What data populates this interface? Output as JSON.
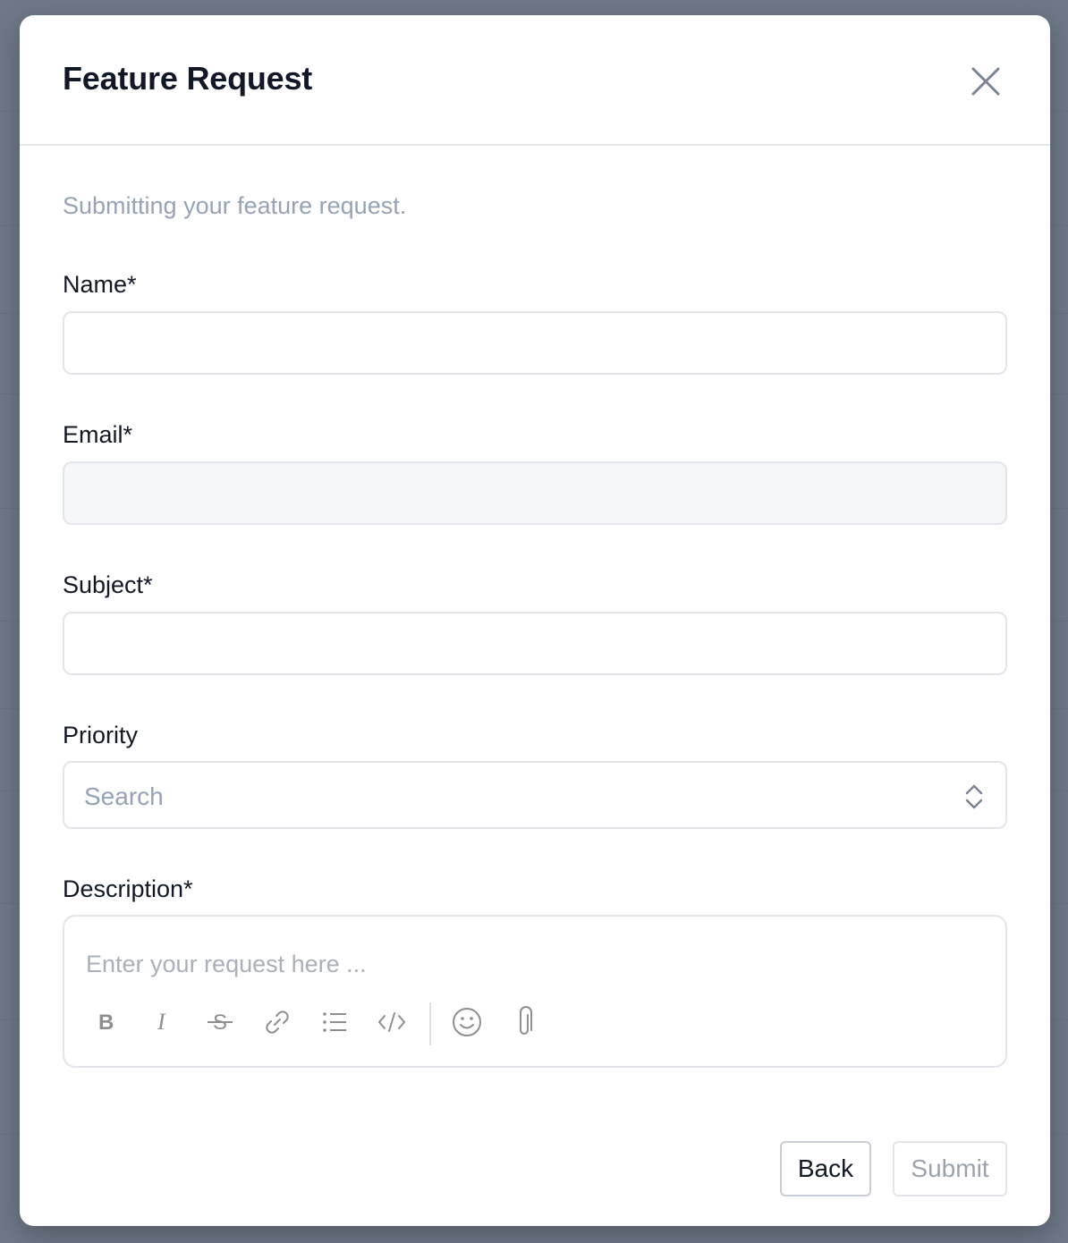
{
  "modal": {
    "title": "Feature Request",
    "subtitle": "Submitting your feature request."
  },
  "form": {
    "name": {
      "label": "Name*",
      "value": ""
    },
    "email": {
      "label": "Email*",
      "value": ""
    },
    "subject": {
      "label": "Subject*",
      "value": ""
    },
    "priority": {
      "label": "Priority",
      "placeholder": "Search"
    },
    "description": {
      "label": "Description*",
      "placeholder": "Enter your request here ...",
      "toolbar": [
        "bold-icon",
        "italic-icon",
        "strikethrough-icon",
        "link-icon",
        "bullet-list-icon",
        "code-icon",
        "emoji-icon",
        "attachment-icon"
      ]
    }
  },
  "actions": {
    "back_label": "Back",
    "submit_label": "Submit"
  },
  "colors": {
    "title": "#111827",
    "muted": "#94a3b8",
    "border": "#e2e5ea",
    "overlay": "#6b7686"
  }
}
